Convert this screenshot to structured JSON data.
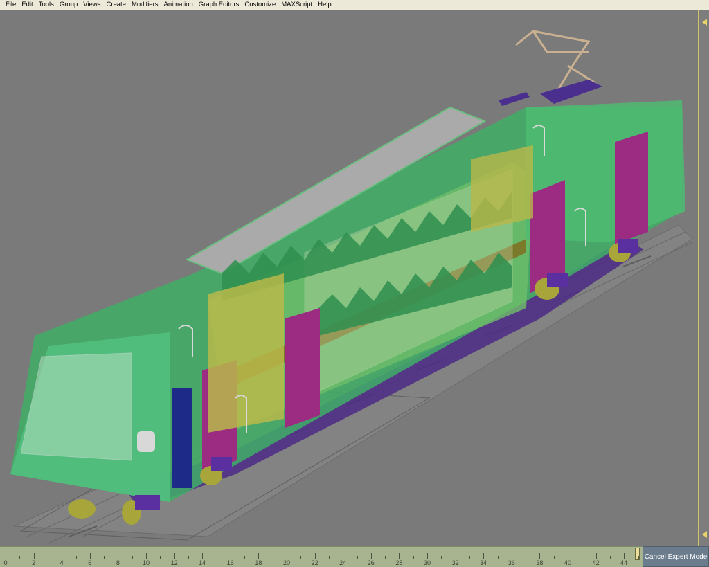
{
  "menu": {
    "items": [
      "File",
      "Edit",
      "Tools",
      "Group",
      "Views",
      "Create",
      "Modifiers",
      "Animation",
      "Graph Editors",
      "Customize",
      "MAXScript",
      "Help"
    ]
  },
  "timeline": {
    "ticks": [
      "0",
      "2",
      "4",
      "6",
      "8",
      "10",
      "12",
      "14",
      "16",
      "18",
      "20",
      "22",
      "24",
      "26",
      "28",
      "30",
      "32",
      "34",
      "36",
      "38",
      "40",
      "42",
      "44"
    ],
    "current_frame": 44
  },
  "buttons": {
    "cancel_expert_mode": "Cancel Expert Mode"
  },
  "colors": {
    "viewport_bg": "#7a7a7a",
    "train_green": "#3fae66",
    "train_light_green": "#62c98a",
    "door_magenta": "#9b2c82",
    "interior_yellow": "#b9b84a",
    "wheel_purple": "#5a2fa0",
    "wheel_yellow": "#a8a63a"
  },
  "icons": {
    "right_marker_top": "triangle-left-icon",
    "right_marker_bottom": "triangle-left-icon"
  }
}
